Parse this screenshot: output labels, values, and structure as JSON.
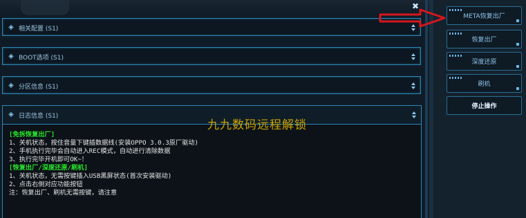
{
  "panels": [
    {
      "title": "相关配置 (S1)"
    },
    {
      "title": "BOOT选项 (S1)"
    },
    {
      "title": "分区信息 (S1)"
    }
  ],
  "log_panel": {
    "title": "日志信息 (S1)",
    "lines": [
      {
        "text": "[免拆恢复出厂]",
        "head": true
      },
      {
        "text": "1、关机状态，按住音量下键插数据线(安装OPPO 3.0.3原厂驱动)",
        "head": false
      },
      {
        "text": "2、手机执行完毕会自动进入REC模式，自动进行清除数据",
        "head": false
      },
      {
        "text": "3、执行完毕开机即可OK~！",
        "head": false
      },
      {
        "text": "[恢复出厂/深度还原/刷机]",
        "head": true
      },
      {
        "text": "1、关机状态，无需按键插入USB黑屏状态(首次安装驱动)",
        "head": false
      },
      {
        "text": "2、点击右侧对应功能按钮",
        "head": false
      },
      {
        "text": "注：恢复出厂、刷机无需按键，请注意",
        "head": false
      }
    ]
  },
  "watermark": "九九数码远程解锁",
  "close_icon": "✖",
  "right_buttons": [
    {
      "label": "META恢复出厂"
    },
    {
      "label": "恢复出厂"
    },
    {
      "label": "深度还原"
    },
    {
      "label": "刷机"
    },
    {
      "label": "停止操作"
    }
  ],
  "colors": {
    "accent": "#2f87b7",
    "log_head_text": "#27e32b",
    "watermark": "#c9a200",
    "arrow": "#d4171e"
  },
  "icons": {
    "panel": "layers-icon",
    "sort": "sort-icon",
    "annotation": "red-arrow-icon"
  }
}
